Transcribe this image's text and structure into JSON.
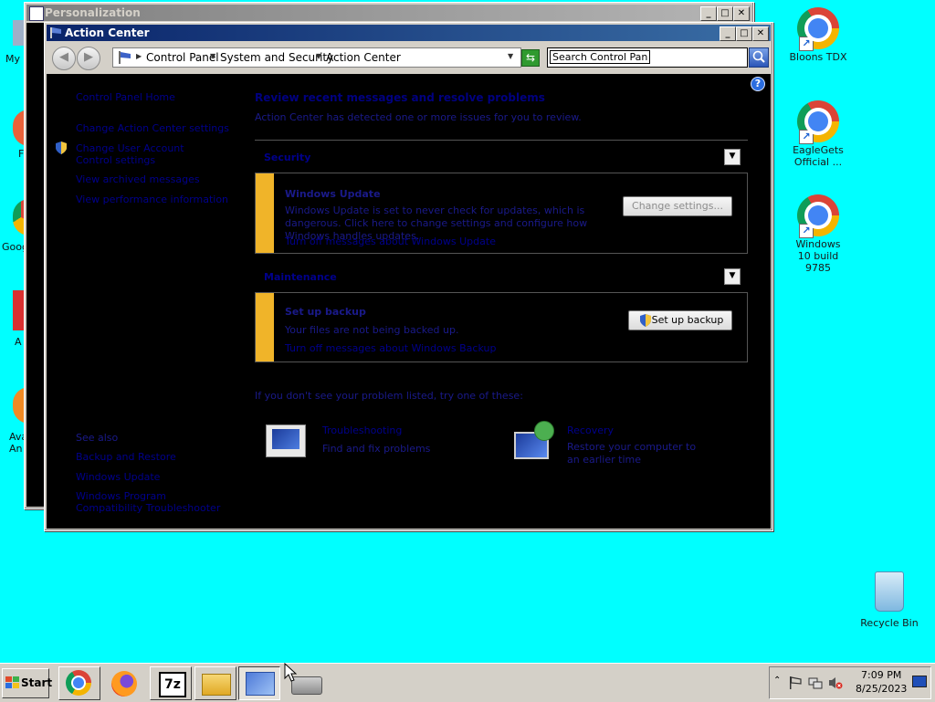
{
  "desktop": {
    "left_icons": [
      {
        "label": "My C"
      },
      {
        "label": "F"
      },
      {
        "label": "Goog"
      },
      {
        "label": "A"
      },
      {
        "label": "Ava\nAn"
      }
    ],
    "right_icons": [
      {
        "label": "Bloons TDX"
      },
      {
        "label": "EagleGets Official ..."
      },
      {
        "label": "Windows 10 build 9785"
      }
    ],
    "recycle_bin": {
      "label": "Recycle Bin"
    }
  },
  "personalization_window": {
    "title": "Personalization"
  },
  "action_center": {
    "title": "Action Center",
    "breadcrumb": [
      "Control Panel",
      "System and Security",
      "Action Center"
    ],
    "search_placeholder": "Search Control Panel",
    "sidebar": {
      "links": [
        "Control Panel Home",
        "Change Action Center settings",
        "Change User Account Control settings",
        "View archived messages",
        "View performance information"
      ],
      "see_also_heading": "See also",
      "see_also": [
        "Backup and Restore",
        "Windows Update",
        "Windows Program Compatibility Troubleshooter"
      ]
    },
    "main": {
      "heading": "Review recent messages and resolve problems",
      "subheading": "Action Center has detected one or more issues for you to review.",
      "security": {
        "title": "Security",
        "message_title": "Windows Update",
        "message_text": "Windows Update is set to never check for updates, which is dangerous. Click here to change settings and configure how Windows handles updates.",
        "message_link": "Turn off messages about Windows Update",
        "button": "Change settings..."
      },
      "maintenance": {
        "title": "Maintenance",
        "message_title": "Set up backup",
        "message_text": "Your files are not being backed up.",
        "message_link": "Turn off messages about Windows Backup",
        "button": "Set up backup"
      },
      "bottom_note": "If you don't see your problem listed, try one of these:",
      "tools": [
        {
          "title": "Troubleshooting",
          "desc": "Find and fix problems"
        },
        {
          "title": "Recovery",
          "desc": "Restore your computer to an earlier time"
        }
      ]
    }
  },
  "taskbar": {
    "start_label": "Start",
    "time": "7:09 PM",
    "date": "8/25/2023"
  }
}
